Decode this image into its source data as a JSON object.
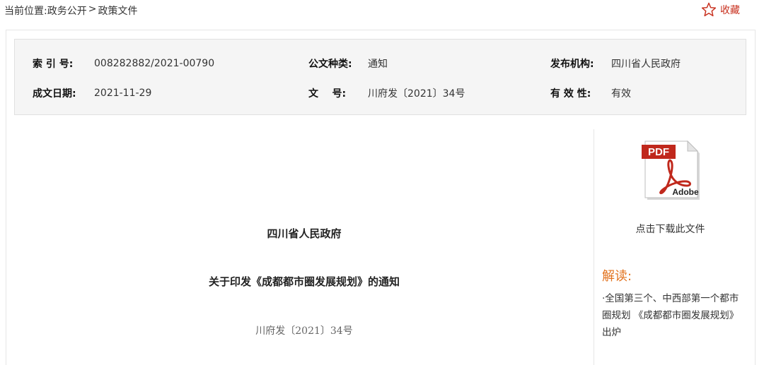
{
  "breadcrumb": {
    "prefix": "当前位置:",
    "item1": "政务公开",
    "sep": ">",
    "item2": "政策文件"
  },
  "favorite": {
    "label": "收藏",
    "icon": "star-outline-icon",
    "color": "#c8301e"
  },
  "meta": {
    "index_no_label": "索 引 号:",
    "index_no_value": "008282882/2021-00790",
    "doc_type_label": "公文种类:",
    "doc_type_value": "通知",
    "issuer_label": "发布机构:",
    "issuer_value": "四川省人民政府",
    "date_label": "成文日期:",
    "date_value": "2021-11-29",
    "doc_no_label": "文    号:",
    "doc_no_value": "川府发〔2021〕34号",
    "validity_label": "有 效 性:",
    "validity_value": "有效"
  },
  "document": {
    "org": "四川省人民政府",
    "title": "关于印发《成都都市圈发展规划》的通知",
    "number": "川府发〔2021〕34号"
  },
  "sidebar": {
    "pdf_icon": "pdf-adobe-icon",
    "pdf_badge": "PDF",
    "pdf_brand": "Adobe",
    "download_label": "点击下载此文件",
    "interpretation_heading": "解读:",
    "interpretation_link": "·全国第三个、中西部第一个都市圈规划 《成都都市圈发展规划》出炉",
    "accent_color": "#e2731f"
  }
}
